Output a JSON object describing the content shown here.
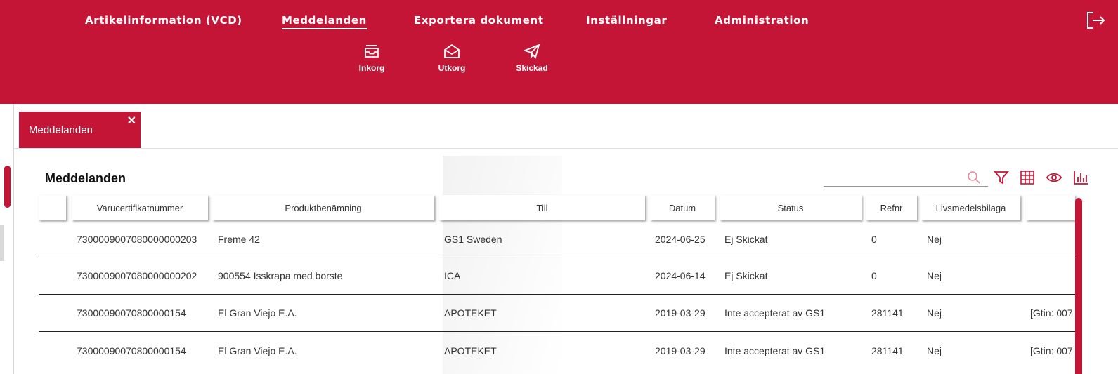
{
  "nav": {
    "items": [
      {
        "label": "Artikelinformation (VCD)",
        "active": false
      },
      {
        "label": "Meddelanden",
        "active": true
      },
      {
        "label": "Exportera dokument",
        "active": false
      },
      {
        "label": "Inställningar",
        "active": false
      },
      {
        "label": "Administration",
        "active": false
      }
    ]
  },
  "subnav": {
    "items": [
      {
        "label": "Inkorg",
        "icon": "inbox-icon"
      },
      {
        "label": "Utkorg",
        "icon": "envelope-open-icon"
      },
      {
        "label": "Skickad",
        "icon": "paper-plane-icon"
      }
    ]
  },
  "tabs": [
    {
      "label": "Meddelanden",
      "close": "✕"
    }
  ],
  "main": {
    "title": "Meddelanden",
    "search": {
      "placeholder": "",
      "value": ""
    },
    "toolbar_icons": [
      "filter-icon",
      "grid-icon",
      "eye-icon",
      "bar-chart-icon"
    ]
  },
  "table": {
    "columns": [
      "",
      "Varucertifikatnummer",
      "Produktbenämning",
      "Till",
      "Datum",
      "Status",
      "Refnr",
      "Livsmedelsbilaga",
      ""
    ],
    "rows": [
      [
        "",
        "7300009007080000000203",
        "Freme 42",
        "GS1 Sweden",
        "2024-06-25",
        "Ej Skickat",
        "0",
        "Nej",
        ""
      ],
      [
        "",
        "7300009007080000000202",
        "900554 Isskrapa med borste",
        "ICA",
        "2024-06-14",
        "Ej Skickat",
        "0",
        "Nej",
        ""
      ],
      [
        "",
        "73000090070800000154",
        "El Gran Viejo E.A.",
        "APOTEKET",
        "2019-03-29",
        "Inte accepterat  av GS1",
        "281141",
        "Nej",
        "[Gtin: 007"
      ],
      [
        "",
        "73000090070800000154",
        "El Gran Viejo E.A.",
        "APOTEKET",
        "2019-03-29",
        "Inte accepterat  av GS1",
        "281141",
        "Nej",
        "[Gtin: 007"
      ]
    ]
  },
  "colors": {
    "brand": "#c41536"
  }
}
